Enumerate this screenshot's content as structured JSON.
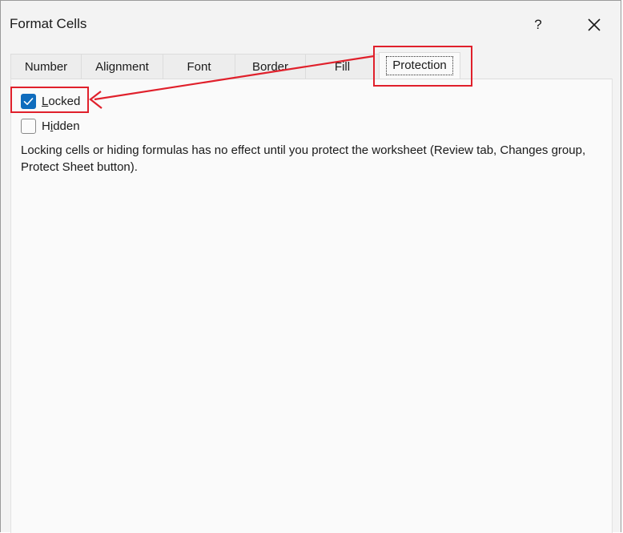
{
  "window": {
    "title": "Format Cells",
    "help_label": "?"
  },
  "tabs": [
    {
      "label": "Number"
    },
    {
      "label": "Alignment"
    },
    {
      "label": "Font"
    },
    {
      "label": "Border"
    },
    {
      "label": "Fill"
    },
    {
      "label": "Protection",
      "active": true
    }
  ],
  "protection": {
    "locked": {
      "mnemonic": "L",
      "rest": "ocked",
      "checked": true
    },
    "hidden": {
      "pre": "H",
      "mnemonic": "i",
      "rest": "dden",
      "checked": false
    },
    "description": "Locking cells or hiding formulas has no effect until you protect the worksheet (Review tab, Changes group, Protect Sheet button)."
  },
  "colors": {
    "accent": "#0f6cbd",
    "annotation": "#e0202b"
  }
}
